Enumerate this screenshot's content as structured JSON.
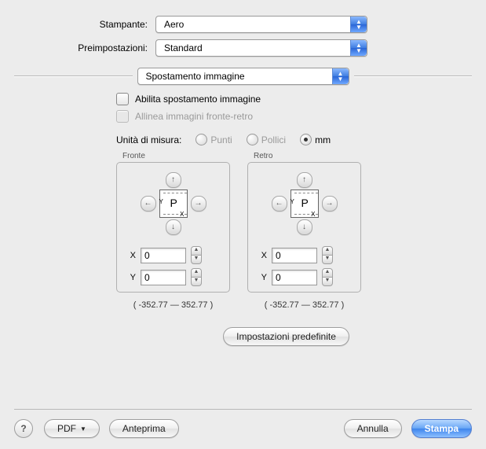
{
  "labels": {
    "printer": "Stampante:",
    "presets": "Preimpostazioni:"
  },
  "selects": {
    "printer": "Aero",
    "preset": "Standard",
    "pane": "Spostamento immagine"
  },
  "checks": {
    "enable": "Abilita spostamento immagine",
    "align": "Allinea immagini fronte-retro"
  },
  "units": {
    "label": "Unità di misura:",
    "points": "Punti",
    "inches": "Pollici",
    "mm": "mm"
  },
  "panels": {
    "front": "Fronte",
    "back": "Retro",
    "x_label": "X",
    "y_label": "Y",
    "front_x": "0",
    "front_y": "0",
    "back_x": "0",
    "back_y": "0",
    "p_mark": "P",
    "y_mark": "Y",
    "x_mark": "X"
  },
  "range": {
    "front": "( -352.77   —   352.77 )",
    "back": "( -352.77   —   352.77 )"
  },
  "buttons": {
    "defaults": "Impostazioni predefinite",
    "help": "?",
    "pdf": "PDF",
    "preview": "Anteprima",
    "cancel": "Annulla",
    "print": "Stampa"
  }
}
